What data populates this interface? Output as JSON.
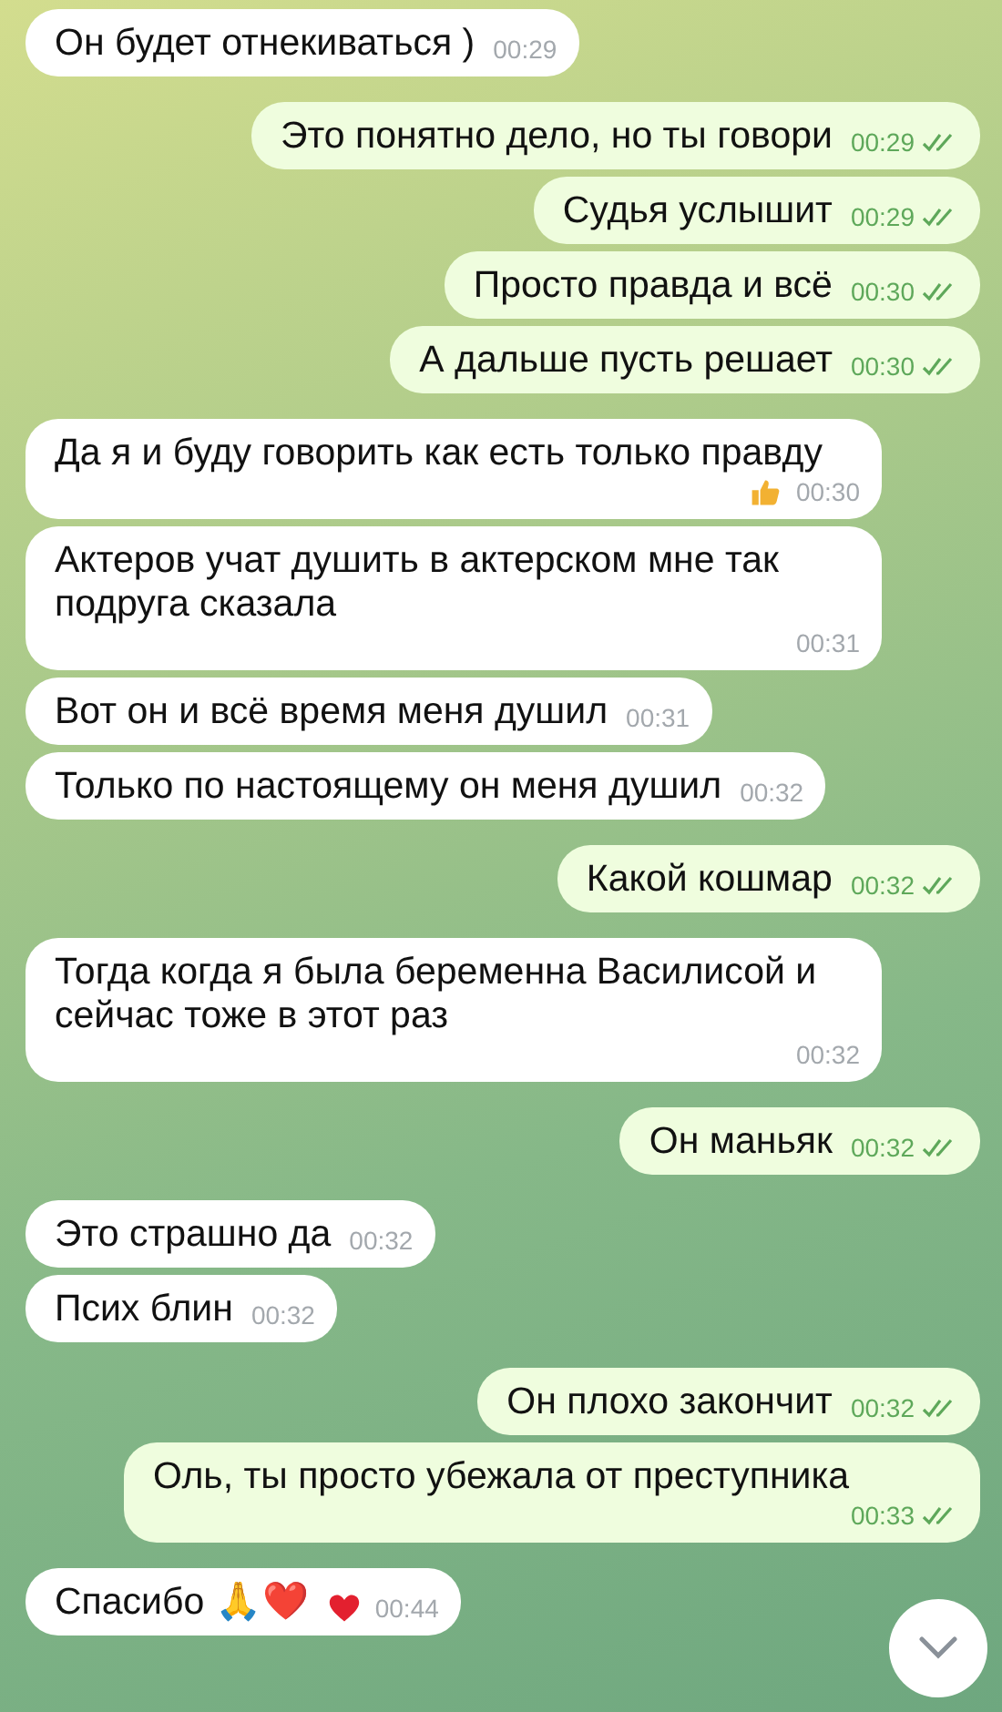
{
  "messages": [
    {
      "outgoing": false,
      "text": "Он будет отнекиваться )",
      "time": "00:29"
    },
    {
      "outgoing": true,
      "text": "Это понятно дело, но ты говори",
      "time": "00:29",
      "read": true
    },
    {
      "outgoing": true,
      "text": "Судья услышит",
      "time": "00:29",
      "read": true
    },
    {
      "outgoing": true,
      "text": "Просто правда и всё",
      "time": "00:30",
      "read": true
    },
    {
      "outgoing": true,
      "text": "А дальше пусть решает",
      "time": "00:30",
      "read": true
    },
    {
      "outgoing": false,
      "text": "Да я и буду говорить как есть только правду",
      "time": "00:30",
      "reaction": {
        "kind": "thumbs_up"
      }
    },
    {
      "outgoing": false,
      "text": "Актеров учат душить в актерском мне так подруга сказала",
      "time": "00:31"
    },
    {
      "outgoing": false,
      "text": "Вот он и всё время меня душил",
      "time": "00:31"
    },
    {
      "outgoing": false,
      "text": "Только по настоящему он меня душил",
      "time": "00:32"
    },
    {
      "outgoing": true,
      "text": "Какой кошмар",
      "time": "00:32",
      "read": true
    },
    {
      "outgoing": false,
      "text": "Тогда когда я была беременна Василисой и сейчас тоже в этот раз",
      "time": "00:32"
    },
    {
      "outgoing": true,
      "text": "Он маньяк",
      "time": "00:32",
      "read": true
    },
    {
      "outgoing": false,
      "text": "Это страшно да",
      "time": "00:32"
    },
    {
      "outgoing": false,
      "text": "Псих блин",
      "time": "00:32"
    },
    {
      "outgoing": true,
      "text": "Он плохо закончит",
      "time": "00:32",
      "read": true
    },
    {
      "outgoing": true,
      "text": "Оль, ты просто убежала от преступника",
      "time": "00:33",
      "read": true
    },
    {
      "outgoing": false,
      "text": "Спасибо 🙏❤️",
      "time": "00:44",
      "reaction": {
        "kind": "heart"
      }
    }
  ],
  "scroll_down_button": {
    "visible": true
  }
}
